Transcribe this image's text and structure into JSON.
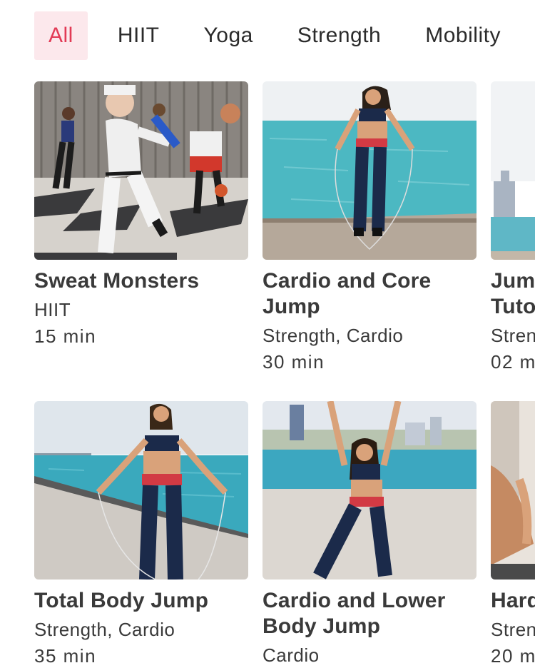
{
  "filters": {
    "tabs": [
      {
        "label": "All",
        "active": true
      },
      {
        "label": "HIIT",
        "active": false
      },
      {
        "label": "Yoga",
        "active": false
      },
      {
        "label": "Strength",
        "active": false
      },
      {
        "label": "Mobility",
        "active": false
      }
    ]
  },
  "workouts": [
    {
      "title": "Sweat Monsters",
      "tags": "HIIT",
      "duration": "15 min",
      "image": "studio-group-workout-photo"
    },
    {
      "title": "Cardio and Core Jump",
      "tags": "Strength, Cardio",
      "duration": "30 min",
      "image": "lakeside-jump-rope-photo"
    },
    {
      "title": "Jum\nTuto",
      "tags": "Stren",
      "duration": "02 m",
      "image": "city-skyline-lake-photo"
    },
    {
      "title": "Total Body Jump",
      "tags": "Strength, Cardio",
      "duration": "35 min",
      "image": "lakefront-jump-rope-photo"
    },
    {
      "title": "Cardio and Lower Body Jump",
      "tags": "Cardio",
      "duration": "",
      "image": "arms-raised-lakeside-photo"
    },
    {
      "title": "Hard",
      "tags": "Stren",
      "duration": "20 m",
      "image": "floor-stretch-photo"
    }
  ],
  "colors": {
    "accent": "#e23a55",
    "accent_bg": "#fce8ec",
    "text": "#3a3a3a"
  }
}
